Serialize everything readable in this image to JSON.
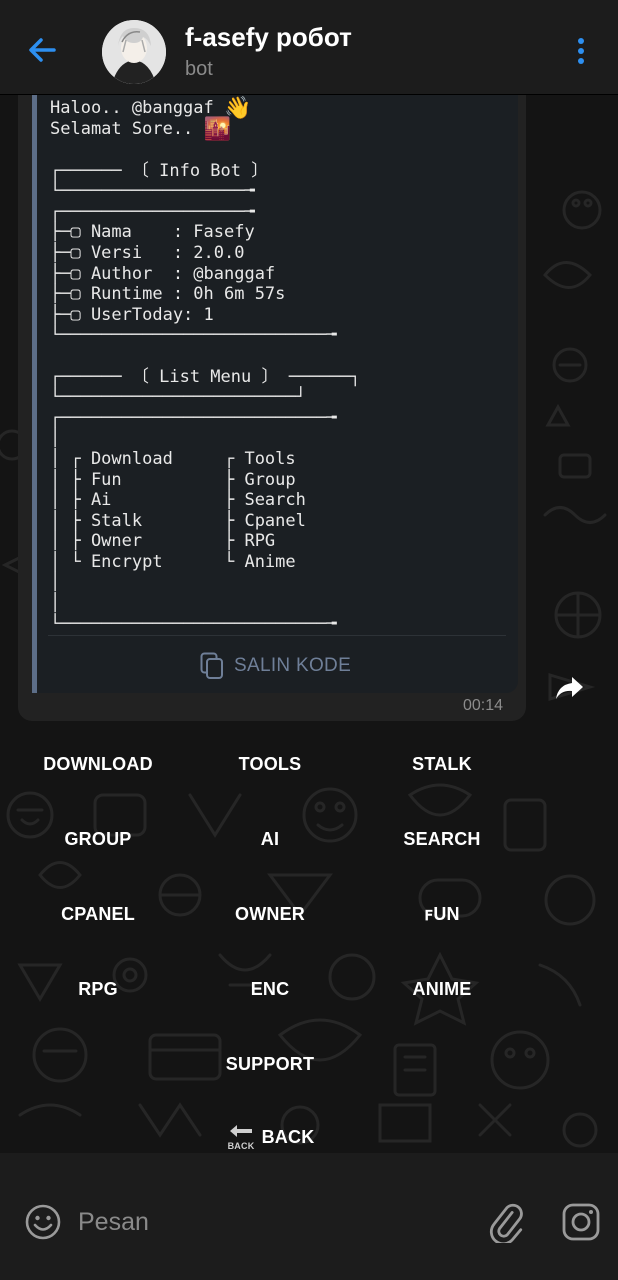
{
  "header": {
    "title": "f-asefy робот",
    "subtitle": "bot"
  },
  "message": {
    "code_lines": [
      "Haloo.. @banggaf ",
      "Selamat Sore.. ",
      "",
      "┌────── 〔 Info Bot 〕",
      "└──────────────────╼",
      "┌──────────────────╼",
      "├─▢ Nama    : Fasefy",
      "├─▢ Versi   : 2.0.0",
      "├─▢ Author  : @banggaf",
      "├─▢ Runtime : 0h 6m 57s",
      "├─▢ UserToday: 1",
      "└──────────────────────────╼",
      "",
      "┌────── 〔 List Menu 〕 ──────┐",
      "└───────────────────────┘",
      "┌──────────────────────────╼",
      "│",
      "│ ┌ Download     ┌ Tools",
      "│ ├ Fun          ├ Group",
      "│ ├ Ai           ├ Search",
      "│ ├ Stalk        ├ Cpanel",
      "│ ├ Owner        ├ RPG",
      "│ └ Encrypt      └ Anime",
      "│",
      "│",
      "└──────────────────────────╼"
    ],
    "emoji_wave": "👋",
    "emoji_sunset": "🌇",
    "copy_label": "SALIN KODE",
    "time": "00:14"
  },
  "keyboard": {
    "buttons": [
      "DOWNLOAD",
      "TOOLS",
      "STALK",
      "GROUP",
      "AI",
      "SEARCH",
      "CPANEL",
      "OWNER",
      "ꜰUN",
      "RPG",
      "ENC",
      "ANIME",
      "SUPPORT"
    ],
    "back_label": "BACK",
    "back_icon_text": "BACK"
  },
  "input": {
    "placeholder": "Pesan"
  },
  "icons": {
    "back": "arrow-left-icon",
    "menu": "more-vert-icon",
    "copy": "copy-icon",
    "forward": "forward-icon",
    "emoji": "smiley-icon",
    "attach": "paperclip-icon",
    "camera": "instagram-camera-icon"
  },
  "colors": {
    "accent": "#2d8ff0",
    "code_border": "#5d6e88",
    "copy_text": "#6f7f98"
  }
}
